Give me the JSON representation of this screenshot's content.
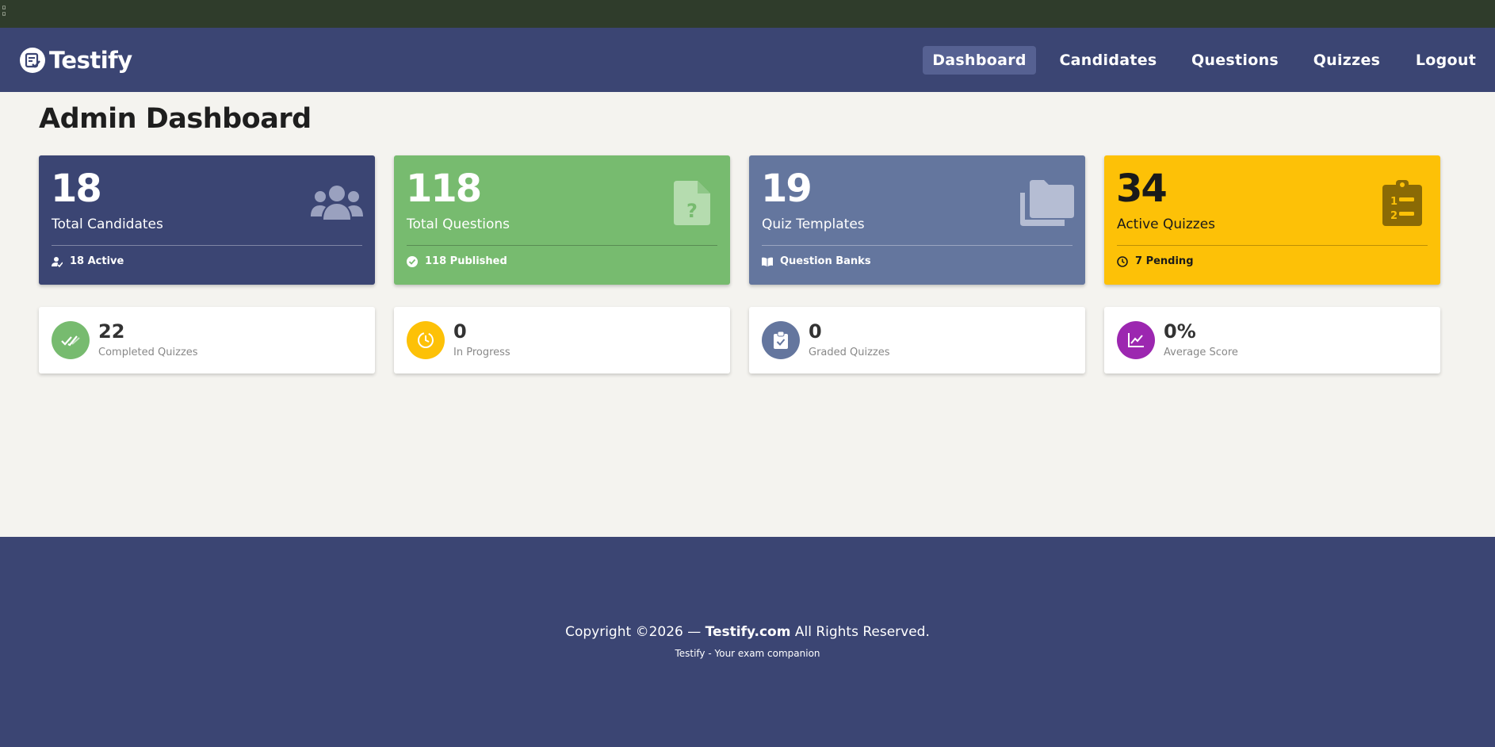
{
  "app": {
    "brand": "Testify"
  },
  "nav": {
    "items": [
      {
        "label": "Dashboard",
        "active": true
      },
      {
        "label": "Candidates"
      },
      {
        "label": "Questions"
      },
      {
        "label": "Quizzes"
      },
      {
        "label": "Logout"
      }
    ]
  },
  "page": {
    "title": "Admin Dashboard"
  },
  "stats": [
    {
      "value": "18",
      "label": "Total Candidates",
      "footer": "18 Active",
      "icon": "users-icon",
      "color": "#3b4573"
    },
    {
      "value": "118",
      "label": "Total Questions",
      "footer": "118 Published",
      "icon": "question-file-icon",
      "color": "#77bb6f"
    },
    {
      "value": "19",
      "label": "Quiz Templates",
      "footer": "Question Banks",
      "icon": "folders-icon",
      "color": "#64769e"
    },
    {
      "value": "34",
      "label": "Active Quizzes",
      "footer": "7 Pending",
      "icon": "clipboard-list-icon",
      "color": "#fdc107"
    }
  ],
  "mini_stats": [
    {
      "value": "22",
      "label": "Completed Quizzes",
      "icon": "double-check-icon",
      "color": "#77bb6f"
    },
    {
      "value": "0",
      "label": "In Progress",
      "icon": "clock-icon",
      "color": "#fdc107"
    },
    {
      "value": "0",
      "label": "Graded Quizzes",
      "icon": "clipboard-check-icon",
      "color": "#64769e"
    },
    {
      "value": "0%",
      "label": "Average Score",
      "icon": "line-chart-icon",
      "color": "#9c27b0"
    }
  ],
  "footer": {
    "copyright_prefix": "Copyright ©2026 —",
    "site": "Testify.com",
    "rights": "All Rights Reserved.",
    "tagline": "Testify - Your exam companion"
  }
}
